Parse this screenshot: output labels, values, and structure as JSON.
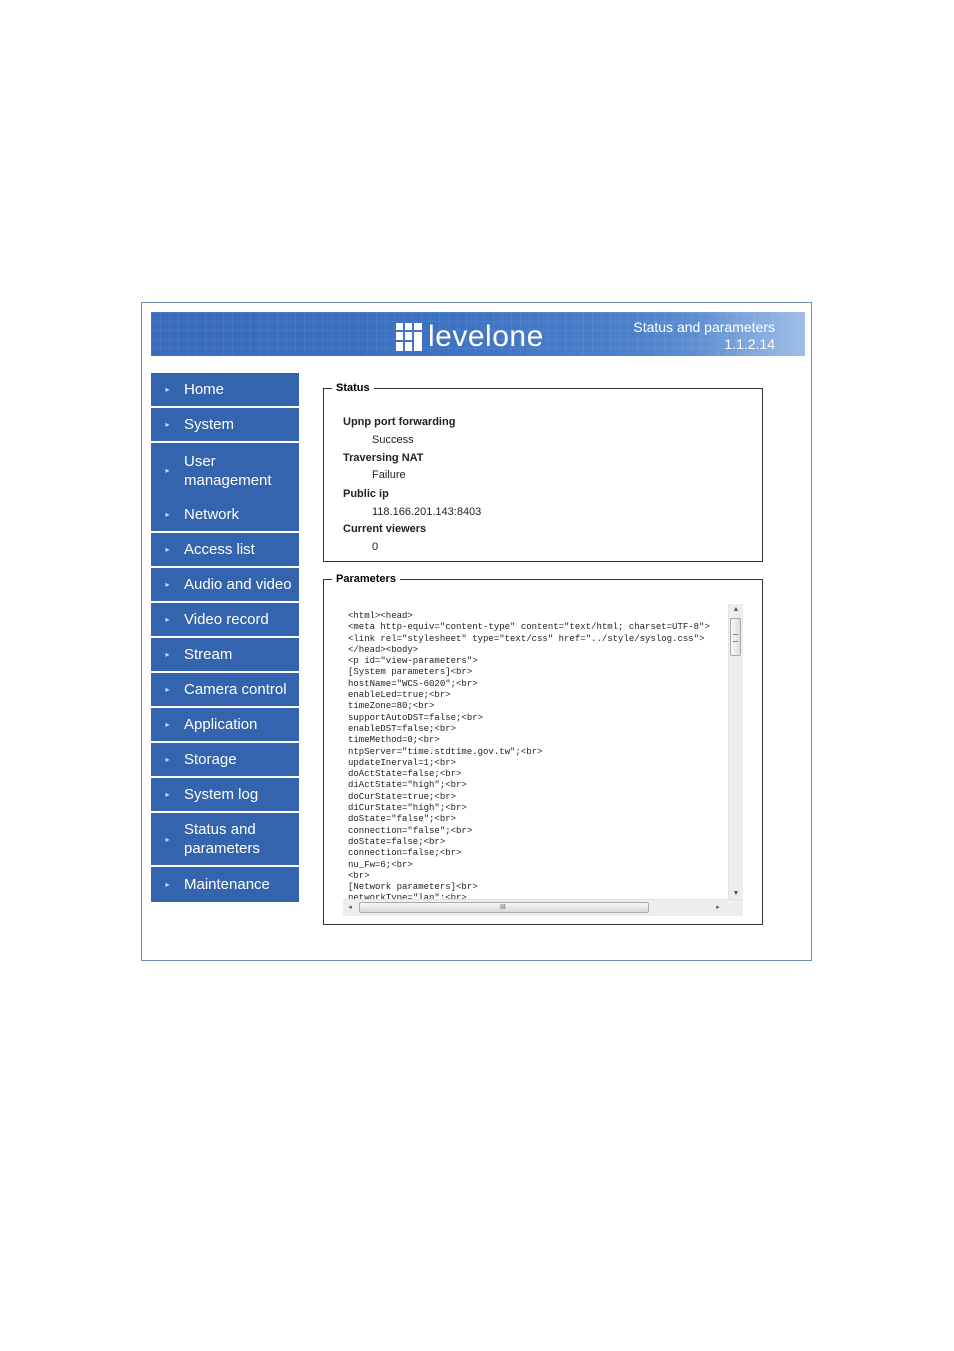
{
  "header": {
    "brand": "levelone",
    "page_title": "Status and parameters",
    "version": "1.1.2.14",
    "banner_color": "#3a6bbd"
  },
  "sidebar": {
    "bullet_icon": "▸",
    "color": "#3464ad",
    "items": [
      {
        "label": "Home"
      },
      {
        "label": "System"
      },
      {
        "label": "User management"
      },
      {
        "label": "Network"
      },
      {
        "label": "Access list"
      },
      {
        "label": "Audio and video"
      },
      {
        "label": "Video record"
      },
      {
        "label": "Stream"
      },
      {
        "label": "Camera control"
      },
      {
        "label": "Application"
      },
      {
        "label": "Storage"
      },
      {
        "label": "System log"
      },
      {
        "label": "Status and parameters"
      },
      {
        "label": "Maintenance"
      }
    ]
  },
  "status": {
    "legend": "Status",
    "rows": [
      {
        "label": "Upnp port forwarding",
        "value": "Success"
      },
      {
        "label": "Traversing NAT",
        "value": "Failure"
      },
      {
        "label": "Public ip",
        "value": "118.166.201.143:8403"
      },
      {
        "label": "Current viewers",
        "value": "0"
      }
    ]
  },
  "parameters": {
    "legend": "Parameters",
    "lines": [
      "<html><head>",
      "<meta http-equiv=\"content-type\" content=\"text/html; charset=UTF-8\">",
      "<link rel=\"stylesheet\" type=\"text/css\" href=\"../style/syslog.css\">",
      "</head><body>",
      "<p id=\"view-parameters\">",
      "[System parameters]<br>",
      "hostName=\"WCS-6020\";<br>",
      "enableLed=true;<br>",
      "timeZone=80;<br>",
      "supportAutoDST=false;<br>",
      "enableDST=false;<br>",
      "timeMethod=0;<br>",
      "ntpServer=\"time.stdtime.gov.tw\";<br>",
      "updateInerval=1;<br>",
      "doActState=false;<br>",
      "diActState=\"high\";<br>",
      "doCurState=true;<br>",
      "diCurState=\"high\";<br>",
      "doState=\"false\";<br>",
      "connection=\"false\";<br>",
      "doState=false;<br>",
      "connection=false;<br>",
      "nu_Fw=6;<br>",
      "<br>",
      "[Network parameters]<br>",
      "networkType=\"lan\";<br>"
    ],
    "scroll": {
      "up_icon": "▲",
      "down_icon": "▼",
      "left_icon": "◂",
      "right_icon": "▸",
      "grip": "III"
    }
  }
}
